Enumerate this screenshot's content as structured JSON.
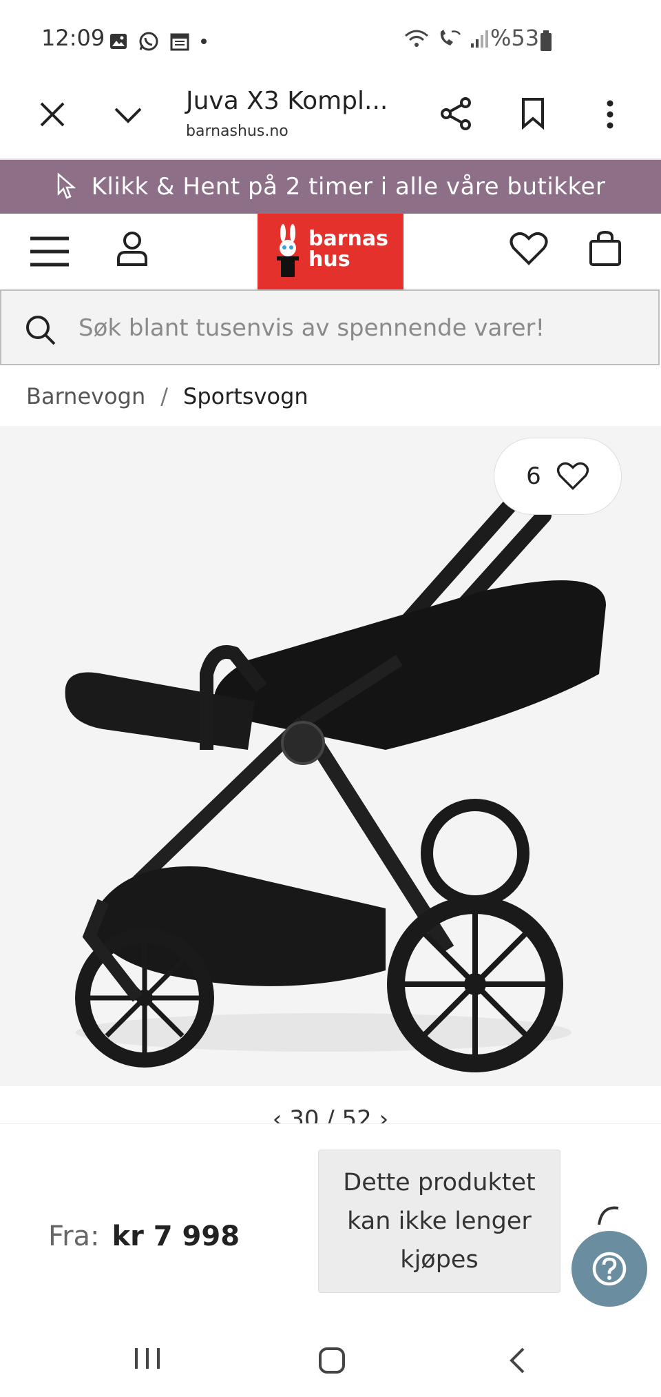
{
  "status_bar": {
    "time": "12:09",
    "battery": "%53",
    "icons": [
      "gallery-icon",
      "whatsapp-icon",
      "calendar-icon",
      "dot-icon",
      "wifi-icon",
      "wifi-calling-icon",
      "signal-icon",
      "battery-icon"
    ]
  },
  "browser": {
    "title": "Juva X3 Kompl...",
    "url": "barnashus.no",
    "icons": [
      "close-icon",
      "chevron-down-icon",
      "share-icon",
      "bookmark-icon",
      "more-vertical-icon"
    ]
  },
  "promo": {
    "text": "Klikk & Hent på 2 timer i alle våre butikker",
    "icon": "cursor-icon",
    "color": "#8d6f88"
  },
  "header": {
    "logo_line1": "barnas",
    "logo_line2": "hus",
    "logo_color": "#e4312b",
    "icons": [
      "menu-icon",
      "user-icon",
      "heart-icon",
      "shopping-bag-icon"
    ]
  },
  "search": {
    "placeholder": "Søk blant tusenvis av spennende varer!"
  },
  "breadcrumb": {
    "items": [
      "Barnevogn",
      "Sportsvogn"
    ],
    "separator": "/"
  },
  "gallery": {
    "favorite_count": "6",
    "pager": "30 / 52"
  },
  "product": {
    "price_label": "Fra:",
    "price": "kr 7 998",
    "unavailable_text": "Dette produktet kan ikke lenger kjøpes"
  },
  "help_color": "#6a8da0",
  "nav_bar": {
    "icons": [
      "recent-apps-icon",
      "home-icon",
      "back-icon"
    ]
  }
}
